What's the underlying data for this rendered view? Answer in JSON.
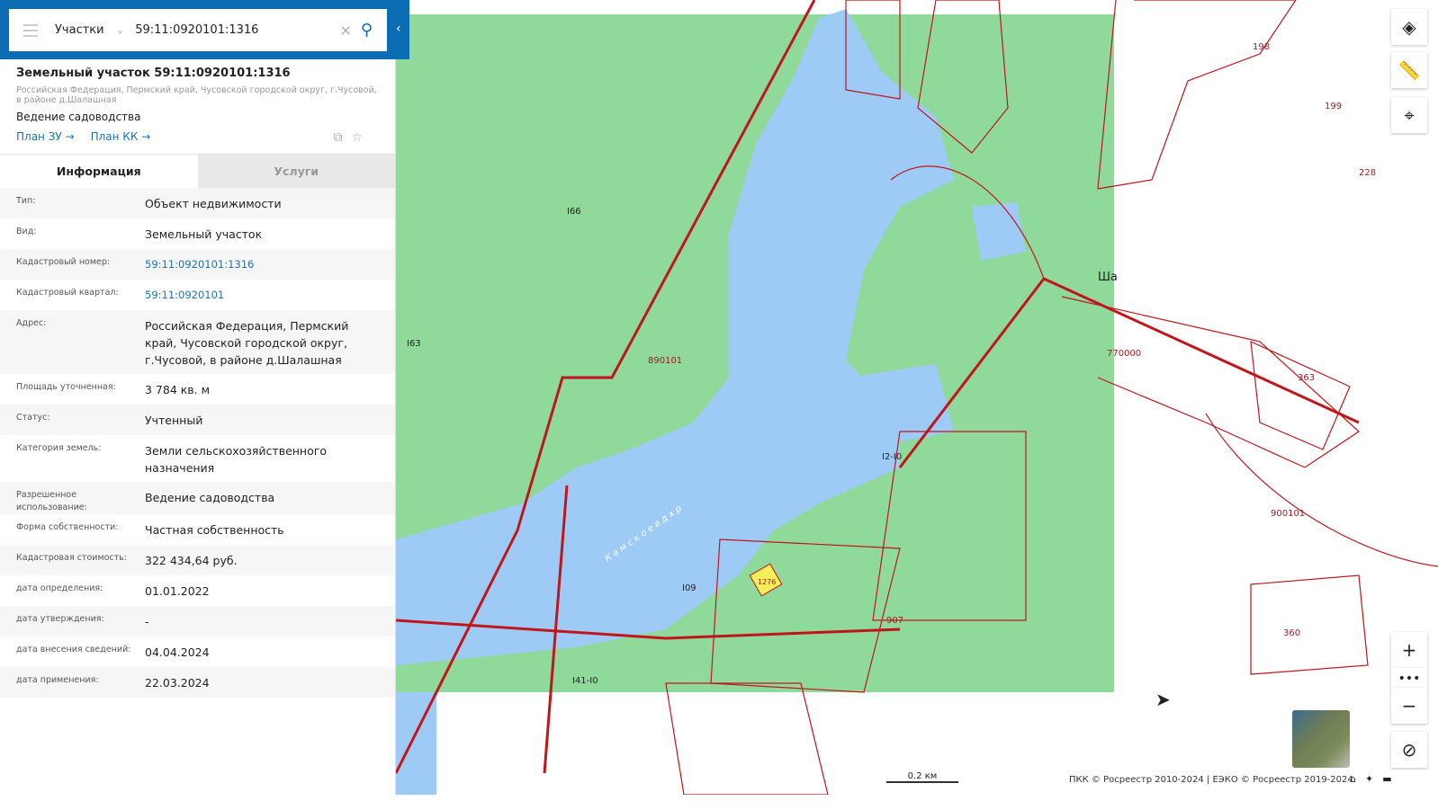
{
  "search": {
    "category": "Участки",
    "value": "59:11:0920101:1316"
  },
  "object": {
    "title": "Земельный участок 59:11:0920101:1316",
    "address": "Российская Федерация, Пермский край, Чусовской городской округ, г.Чусовой, в районе д.Шалашная",
    "purpose": "Ведение садоводства",
    "link_zu": "План ЗУ →",
    "link_kk": "План КК →"
  },
  "tabs": [
    {
      "label": "Информация"
    },
    {
      "label": "Услуги"
    }
  ],
  "rows": [
    {
      "label": "Тип:",
      "value": "Объект недвижимости"
    },
    {
      "label": "Вид:",
      "value": "Земельный участок"
    },
    {
      "label": "Кадастровый номер:",
      "value": "59:11:0920101:1316"
    },
    {
      "label": "Кадастровый квартал:",
      "value": "59:11:0920101"
    },
    {
      "label": "Адрес:",
      "value": "Российская Федерация, Пермский край, Чусовской городской округ, г.Чусовой, в районе д.Шалашная"
    },
    {
      "label": "Площадь уточненная:",
      "value": "3 784 кв. м"
    },
    {
      "label": "Статус:",
      "value": "Учтенный"
    },
    {
      "label": "Категория земель:",
      "value": "Земли сельскохозяйственного назначения"
    },
    {
      "label": "Разрешенное использование:",
      "value": "Ведение садоводства"
    },
    {
      "label": "Форма собственности:",
      "value": "Частная собственность"
    },
    {
      "label": "Кадастровая стоимость:",
      "value": "322 434,64 руб."
    },
    {
      "label": "дата определения:",
      "value": "01.01.2022"
    },
    {
      "label": "дата утверждения:",
      "value": "-"
    },
    {
      "label": "дата внесения сведений:",
      "value": "04.04.2024"
    },
    {
      "label": "дата применения:",
      "value": "22.03.2024"
    }
  ],
  "map": {
    "labels": [
      "I66",
      "I63",
      "890101",
      "I09",
      "I2-I0",
      "I41-I0",
      "900101",
      "770000",
      "363",
      "360",
      "199",
      "198",
      "228",
      "907",
      "1276",
      "Ша"
    ],
    "scale": "0.2 км",
    "attribution": "ПКК © Росреестр 2010-2024 | ЕЭКО © Росреестр 2019-2024",
    "river": "К а м с к о е   в д х р"
  },
  "colors": {
    "header": "#0b6cb4",
    "forest": "#8fd99a",
    "water": "#9ecbf5",
    "border": "#c0151b"
  }
}
